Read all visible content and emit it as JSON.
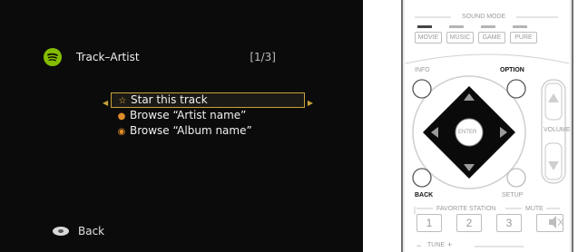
{
  "screen": {
    "title": "Track–Artist",
    "page_indicator": "[1/3]",
    "menu": [
      {
        "label": "Star this track",
        "icon": "star-icon",
        "selected": true
      },
      {
        "label": "Browse “Artist name”",
        "icon": "person-icon",
        "selected": false
      },
      {
        "label": "Browse “Album name”",
        "icon": "disc-icon",
        "selected": false
      }
    ],
    "back_label": "Back"
  },
  "remote": {
    "sound_mode_label": "SOUND MODE",
    "mode_buttons": [
      "MOVIE",
      "MUSIC",
      "GAME",
      "PURE"
    ],
    "info_label": "INFO",
    "option_label": "OPTION",
    "enter_label": "ENTER",
    "volume_label": "VOLUME",
    "back_label": "BACK",
    "setup_label": "SETUP",
    "favorite_station_label": "FAVORITE STATION",
    "mute_label": "MUTE",
    "number_buttons": [
      "1",
      "2",
      "3"
    ],
    "tune_label": "TUNE",
    "tune_minus": "−",
    "tune_plus": "+"
  },
  "colors": {
    "screen_bg": "#0b0b0b",
    "selection_border": "#c8a13a",
    "spotify_green": "#84bd00",
    "pad_black": "#0a0a0a"
  }
}
